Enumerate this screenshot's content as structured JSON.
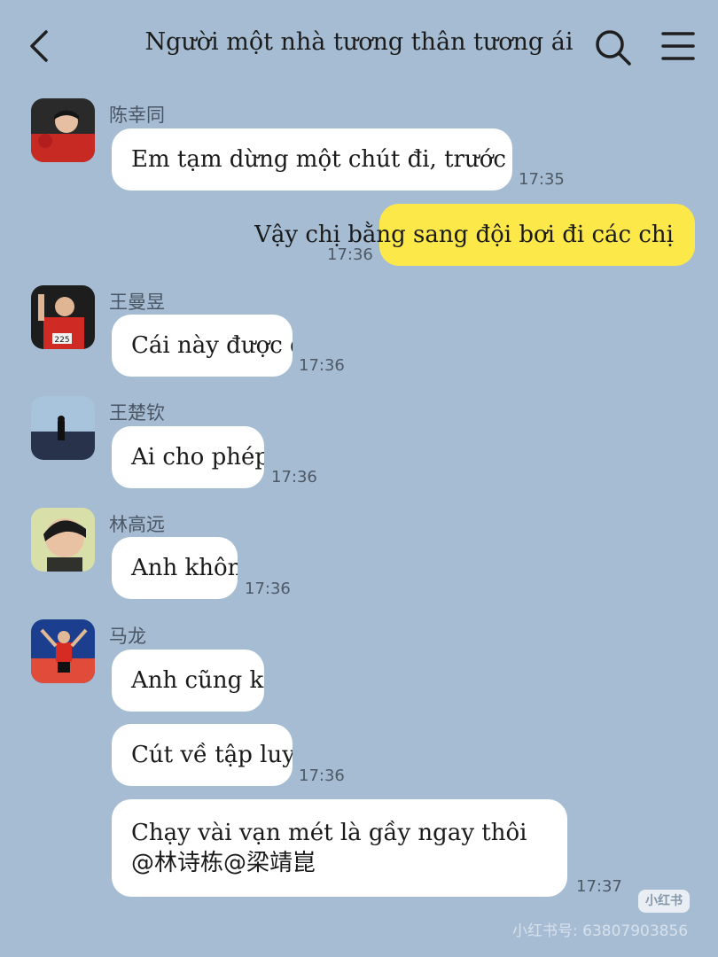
{
  "header": {
    "title": "Người một nhà tương thân tương ái"
  },
  "messages": [
    {
      "sender": "陈幸同",
      "text": "Em tạm dừng một chút đi, trước hết đổi ảnh đại diện đã",
      "time": "17:35"
    },
    {
      "sender": "",
      "text": "Vậy chị bằng sang đội bơi đi các chị",
      "time": "17:36"
    },
    {
      "sender": "王曼昱",
      "text": "Cái này được đấy",
      "time": "17:36"
    },
    {
      "sender": "王楚钦",
      "text": "Ai cho phép vậy?",
      "time": "17:36"
    },
    {
      "sender": "林高远",
      "text": "Anh không có",
      "time": "17:36"
    },
    {
      "sender": "马龙",
      "text": "Anh cũng không có",
      "time": ""
    },
    {
      "sender": "",
      "text": "Cút về tập luyện",
      "time": "17:36"
    },
    {
      "sender": "",
      "text_line1": "Chạy vài vạn mét là gầy ngay thôi",
      "text_line2": "@林诗栋@梁靖崑",
      "time": "17:37"
    }
  ],
  "watermark": {
    "badge": "小红书",
    "id_text": "小红书号: 63807903856"
  },
  "colors": {
    "background": "#a5bcd2",
    "bubble_incoming": "#ffffff",
    "bubble_outgoing": "#fde84a"
  }
}
